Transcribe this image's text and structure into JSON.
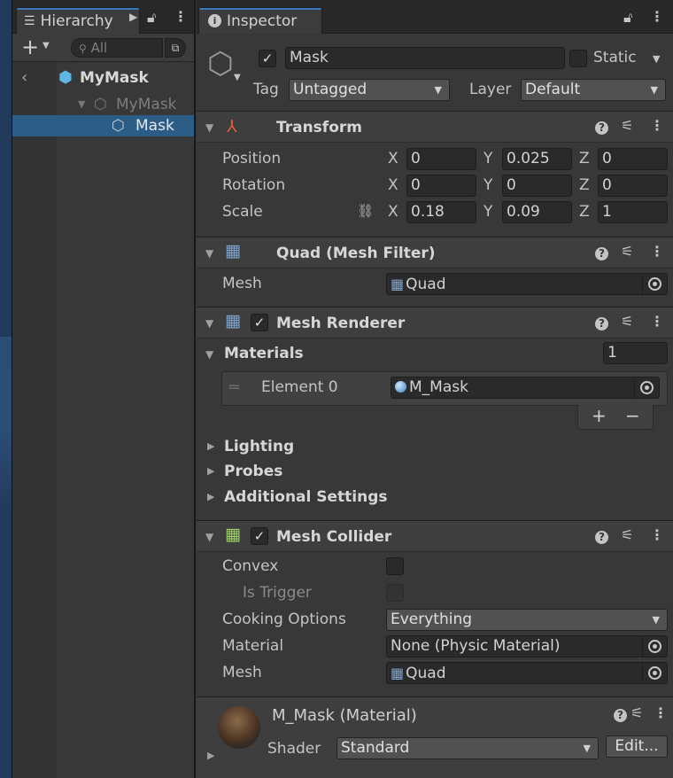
{
  "hierarchy": {
    "tab_label": "Hierarchy",
    "search_placeholder": "All",
    "root": "MyMask",
    "child": "MyMask",
    "selected": "Mask"
  },
  "inspector": {
    "tab_label": "Inspector",
    "object_name": "Mask",
    "static_label": "Static",
    "tag_label": "Tag",
    "tag_value": "Untagged",
    "layer_label": "Layer",
    "layer_value": "Default",
    "transform": {
      "title": "Transform",
      "position_label": "Position",
      "rotation_label": "Rotation",
      "scale_label": "Scale",
      "axis_x": "X",
      "axis_y": "Y",
      "axis_z": "Z",
      "position": {
        "x": "0",
        "y": "0.025",
        "z": "0"
      },
      "rotation": {
        "x": "0",
        "y": "0",
        "z": "0"
      },
      "scale": {
        "x": "0.18",
        "y": "0.09",
        "z": "1"
      }
    },
    "mesh_filter": {
      "title": "Quad (Mesh Filter)",
      "mesh_label": "Mesh",
      "mesh_value": "Quad"
    },
    "mesh_renderer": {
      "title": "Mesh Renderer",
      "materials_label": "Materials",
      "materials_count": "1",
      "element_label": "Element 0",
      "element_value": "M_Mask",
      "add_label": "+",
      "remove_label": "−",
      "lighting_label": "Lighting",
      "probes_label": "Probes",
      "additional_label": "Additional Settings"
    },
    "mesh_collider": {
      "title": "Mesh Collider",
      "convex_label": "Convex",
      "trigger_label": "Is Trigger",
      "cooking_label": "Cooking Options",
      "cooking_value": "Everything",
      "material_label": "Material",
      "material_value": "None (Physic Material)",
      "mesh_label": "Mesh",
      "mesh_value": "Quad"
    },
    "material": {
      "title": "M_Mask (Material)",
      "shader_label": "Shader",
      "shader_value": "Standard",
      "edit_label": "Edit..."
    }
  },
  "colors": {
    "selection": "#2c5d87",
    "tab_accent": "#3a79bb",
    "panel_bg": "#383838",
    "mesh_icon": "#7fa6d3",
    "collider_icon": "#9ed26a"
  }
}
